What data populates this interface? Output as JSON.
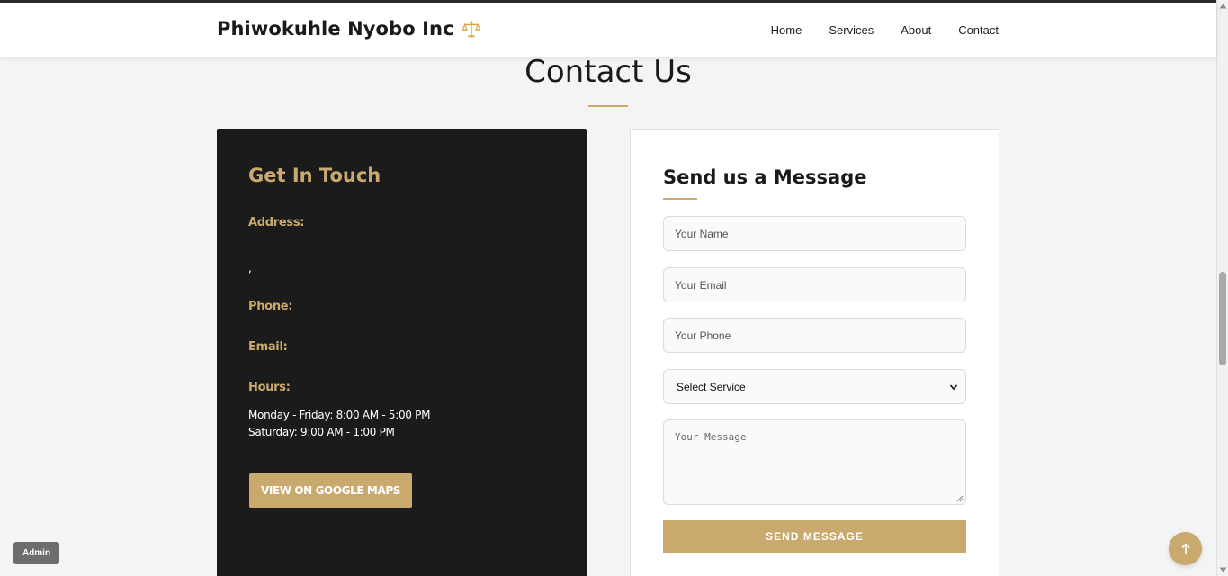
{
  "header": {
    "brand": "Phiwokuhle Nyobo Inc",
    "brand_icon": "scales-icon",
    "nav": [
      "Home",
      "Services",
      "About",
      "Contact"
    ]
  },
  "page": {
    "title": "Contact Us"
  },
  "info": {
    "heading": "Get In Touch",
    "address_label": "Address:",
    "address_value": ",",
    "phone_label": "Phone:",
    "email_label": "Email:",
    "hours_label": "Hours:",
    "hours_weekday": "Monday - Friday: 8:00 AM - 5:00 PM",
    "hours_saturday": "Saturday: 9:00 AM - 1:00 PM",
    "maps_button": "VIEW ON GOOGLE MAPS"
  },
  "form": {
    "heading": "Send us a Message",
    "name_placeholder": "Your Name",
    "email_placeholder": "Your Email",
    "phone_placeholder": "Your Phone",
    "service_selected": "Select Service",
    "message_placeholder": "Your Message",
    "submit_label": "SEND MESSAGE"
  },
  "floating": {
    "admin_label": "Admin",
    "back_to_top_icon": "arrow-up-icon"
  },
  "colors": {
    "accent": "#c9a96e",
    "dark_card": "#1b1b1b",
    "background": "#f4f4f4"
  }
}
